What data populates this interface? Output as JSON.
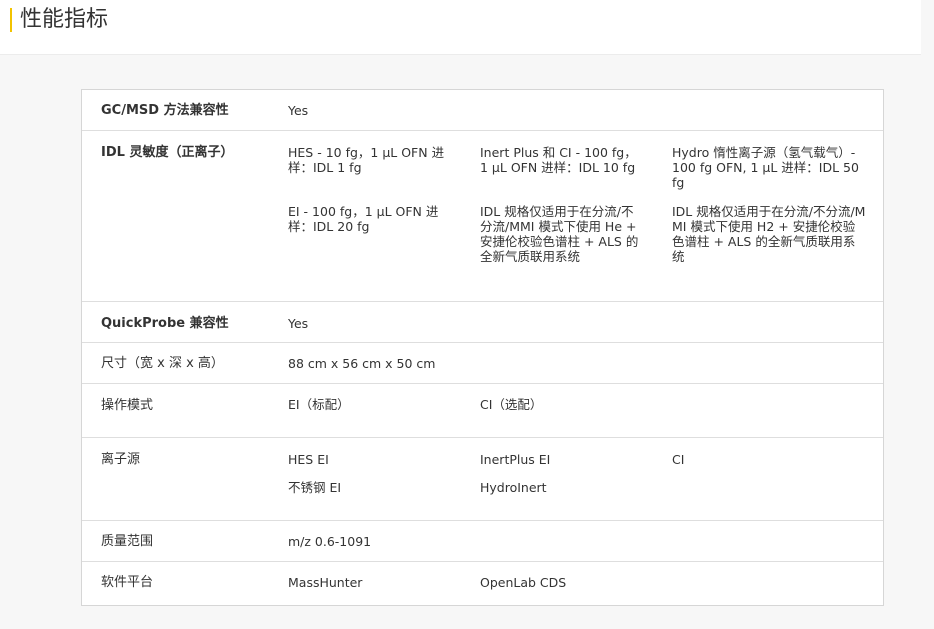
{
  "page": {
    "title": "性能指标"
  },
  "spec_table": {
    "rows": [
      {
        "label": "GC/MSD 方法兼容性",
        "cells": [
          "Yes"
        ]
      },
      {
        "label": "IDL 灵敏度（正离子）",
        "cells": [
          "HES - 10 fg，1 µL OFN 进样：IDL 1 fg",
          "Inert Plus 和 CI - 100 fg，1 µL OFN 进样：IDL 10 fg",
          "Hydro 惰性离子源（氢气载气）- 100 fg OFN, 1 µL 进样：IDL 50 fg",
          "EI - 100 fg，1 µL OFN 进样：IDL 20 fg",
          "IDL 规格仅适用于在分流/不分流/MMI 模式下使用 He + 安捷伦校验色谱柱 + ALS 的全新气质联用系统",
          "IDL 规格仅适用于在分流/不分流/MMI 模式下使用 H2 + 安捷伦校验色谱柱 + ALS 的全新气质联用系统"
        ]
      },
      {
        "label": "QuickProbe 兼容性",
        "cells": [
          "Yes"
        ]
      },
      {
        "label": "尺寸（宽 x 深 x 高）",
        "cells": [
          "88 cm x 56 cm x 50 cm"
        ]
      },
      {
        "label": "操作模式",
        "cells": [
          "EI（标配）",
          "CI（选配）"
        ]
      },
      {
        "label": "离子源",
        "cells": [
          "HES EI",
          "InertPlus EI",
          "CI",
          "不锈钢 EI",
          "HydroInert"
        ]
      },
      {
        "label": "质量范围",
        "cells": [
          "m/z 0.6-1091"
        ]
      },
      {
        "label": "软件平台",
        "cells": [
          "MassHunter",
          "OpenLab CDS"
        ]
      }
    ]
  }
}
